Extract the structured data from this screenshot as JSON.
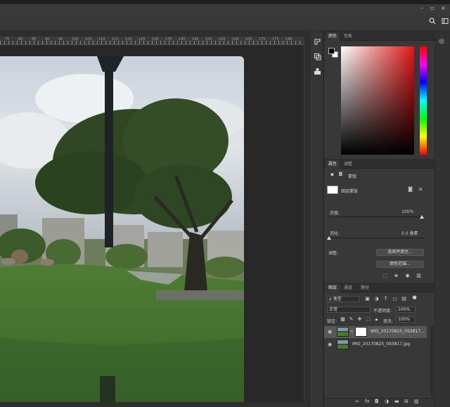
{
  "window": {
    "controls": [
      "–",
      "▫",
      "×"
    ]
  },
  "ruler": {
    "labels": [
      "75",
      "80",
      "85",
      "90",
      "95",
      "100",
      "105",
      "110",
      "115",
      "120",
      "125",
      "130",
      "135",
      "140",
      "145",
      "150",
      "155",
      "160",
      "165",
      "170",
      "175",
      "180"
    ]
  },
  "toolcol": {
    "icons": [
      "history-icon",
      "brush-preset-icon",
      "character-icon"
    ]
  },
  "color_panel": {
    "tabs": [
      "颜色",
      "色板"
    ],
    "fg_color": "#000000",
    "bg_color": "#ffffff"
  },
  "properties_panel": {
    "tabs": [
      "属性",
      "调整"
    ],
    "mode_label": "蒙版",
    "layer_mask_label": "图层蒙版",
    "density_label": "浓度:",
    "density_value": "100%",
    "feather_label": "羽化:",
    "feather_value": "0.0 像素",
    "refine_label": "调整:",
    "select_mask_button": "选择并遮住...",
    "color_range_button": "颜色范围..."
  },
  "layers_panel": {
    "tabs": [
      "图层",
      "通道",
      "路径"
    ],
    "filter_kind": "ρ 类型",
    "blend_mode": "正常",
    "opacity_label": "不透明度:",
    "opacity_value": "100%",
    "lock_label": "锁定:",
    "fill_label": "填充:",
    "fill_value": "100%",
    "layers": [
      {
        "name": "IMG_20170825_093817...",
        "selected": true,
        "has_mask": true
      },
      {
        "name": "IMG_20170825_093817.jpg",
        "selected": false,
        "has_mask": false
      }
    ]
  },
  "colors": {
    "panel_bg": "#383838",
    "app_bg": "#282828",
    "selected_layer": "#575757"
  }
}
